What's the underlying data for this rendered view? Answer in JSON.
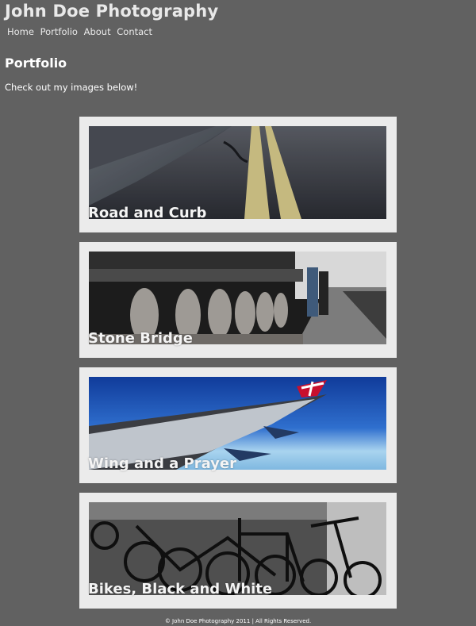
{
  "header": {
    "site_title": "John Doe Photography",
    "nav": [
      "Home",
      "Portfolio",
      "About",
      "Contact"
    ]
  },
  "main": {
    "page_title": "Portfolio",
    "intro": "Check out my images below!",
    "gallery": [
      {
        "caption": "Road and Curb",
        "subject": "road-photo"
      },
      {
        "caption": "Stone Bridge",
        "subject": "bridge-photo"
      },
      {
        "caption": "Wing and a Prayer",
        "subject": "airplane-wing-photo"
      },
      {
        "caption": "Bikes, Black and White",
        "subject": "bicycles-photo"
      }
    ]
  },
  "footer": {
    "copyright": "© John Doe Photography 2011 | All Rights Reserved."
  },
  "colors": {
    "page_background": "#616161",
    "card_background": "#ebebeb",
    "text": "#ffffff"
  }
}
